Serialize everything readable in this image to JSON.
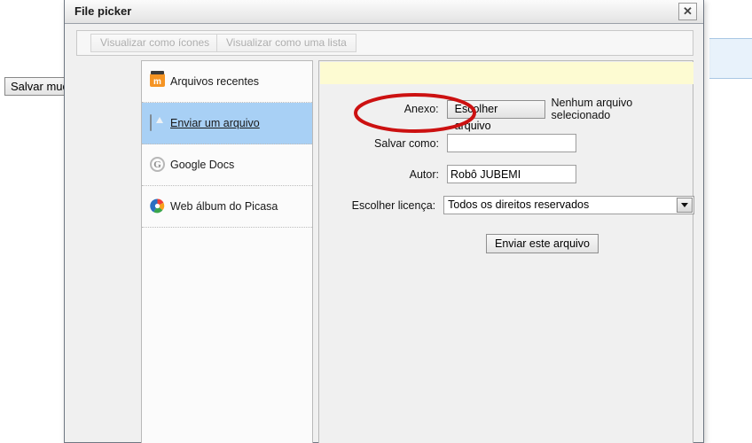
{
  "background": {
    "save_button_label": "Salvar muda",
    "blue_panel": "empty-panel"
  },
  "dialog": {
    "title": "File picker",
    "close_label": "✕",
    "toolbar": {
      "view_icons_label": "Visualizar como ícones",
      "view_list_label": "Visualizar como uma lista"
    },
    "sidebar": {
      "items": [
        {
          "label": "Arquivos recentes",
          "icon": "moodle-icon",
          "selected": false
        },
        {
          "label": "Enviar um arquivo",
          "icon": "upload-icon",
          "selected": true
        },
        {
          "label": "Google Docs",
          "icon": "google-docs-icon",
          "selected": false
        },
        {
          "label": "Web álbum do Picasa",
          "icon": "picasa-icon",
          "selected": false
        }
      ]
    },
    "form": {
      "attachment": {
        "label": "Anexo:",
        "button_label": "Escolher arquivo",
        "status_text": "Nenhum arquivo selecionado"
      },
      "save_as": {
        "label": "Salvar como:",
        "value": "",
        "placeholder": ""
      },
      "author": {
        "label": "Autor:",
        "value": "Robô JUBEMI",
        "placeholder": ""
      },
      "license": {
        "label": "Escolher licença:",
        "selected": "Todos os direitos reservados",
        "options": [
          "Todos os direitos reservados"
        ]
      },
      "submit_label": "Enviar este arquivo"
    }
  },
  "annotation": {
    "shape": "ellipse",
    "color": "#cc1111",
    "target": "Escolher arquivo"
  }
}
